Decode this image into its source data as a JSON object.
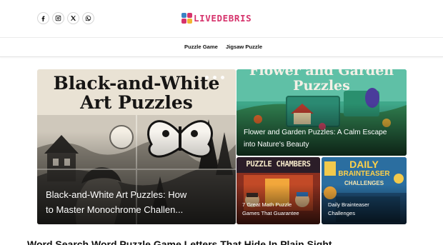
{
  "social": {
    "icons": [
      "facebook-icon",
      "instagram-icon",
      "x-icon",
      "whatsapp-icon"
    ]
  },
  "brand": {
    "name": "LIVEDEBRIS",
    "colors": {
      "pink": "#d6336c",
      "blue": "#3b82c4",
      "yellow": "#f2b632"
    }
  },
  "nav": {
    "items": [
      {
        "label": "Puzzle Game"
      },
      {
        "label": "Jigsaw Puzzle"
      }
    ]
  },
  "featured": {
    "main": {
      "image_heading_1": "Black-and-White",
      "image_heading_2": "Art Puzzles",
      "title_line1": "Black-and-White Art Puzzles: How",
      "title_line2": "to Master Monochrome Challen..."
    },
    "flower": {
      "image_heading_1": "Flower and Garden",
      "image_heading_2": "Puzzles",
      "title_line1": "Flower and Garden Puzzles: A Calm Escape",
      "title_line2": "into Nature's Beauty"
    },
    "chambers": {
      "image_heading": "PUZZLE CHAMBERS",
      "title_line1": "7 Great Math Puzzle",
      "title_line2": "Games That Guarantee"
    },
    "daily": {
      "image_heading_1": "DAILY",
      "image_heading_2": "BRAINTEASER",
      "image_heading_3": "CHALLENGES",
      "title_line1": "Daily Brainteaser",
      "title_line2": "Challenges"
    }
  },
  "below": {
    "headline": "Word Search Word Puzzle Game Letters That Hide In Plain Sight"
  }
}
